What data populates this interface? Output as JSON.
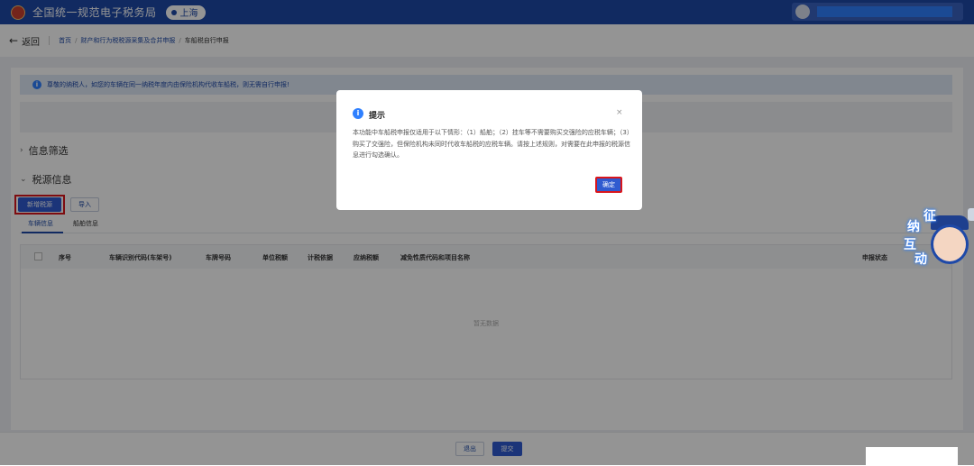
{
  "header": {
    "title": "全国统一规范电子税务局",
    "region": "上海",
    "user_name": ""
  },
  "breadcrumb": {
    "back": "返回",
    "items": [
      "首页",
      "财产和行为税税源采集及合并申报",
      "车船税自行申报"
    ]
  },
  "notice": {
    "text": "尊敬的纳税人，如您的车辆在同一纳税年度内由保险机构代收车船税，则无需自行申报!"
  },
  "sections": {
    "filter": "信息筛选",
    "tax_source": "税源信息"
  },
  "buttons": {
    "add_source": "新增税源",
    "import": "导入",
    "exit": "退出",
    "submit": "提交"
  },
  "tabs": [
    "车辆信息",
    "船舶信息"
  ],
  "table": {
    "columns": [
      "序号",
      "车辆识别代码(车架号)",
      "车牌号码",
      "单位税额",
      "计税依据",
      "应纳税额",
      "减免性质代码和项目名称",
      "申报状态"
    ],
    "empty_text": "暂无数据"
  },
  "dialog": {
    "title": "提示",
    "close": "×",
    "body": "本功能中车船税申报仅适用于以下情形：（1）船舶；（2）挂车等不需要购买交强险的应税车辆；（3）购买了交强险，但保险机构未同时代收车船税的应税车辆。请按上述规则，对需要在此申报的税源信息进行勾选确认。",
    "ok": "确定"
  },
  "mascot": {
    "chars": [
      "征",
      "纳",
      "互",
      "动"
    ]
  },
  "colors": {
    "header_bg": "#1e49a8",
    "primary": "#2f5bd0",
    "highlight_border": "#d9161c",
    "notice_bg": "#dfe9f7"
  }
}
